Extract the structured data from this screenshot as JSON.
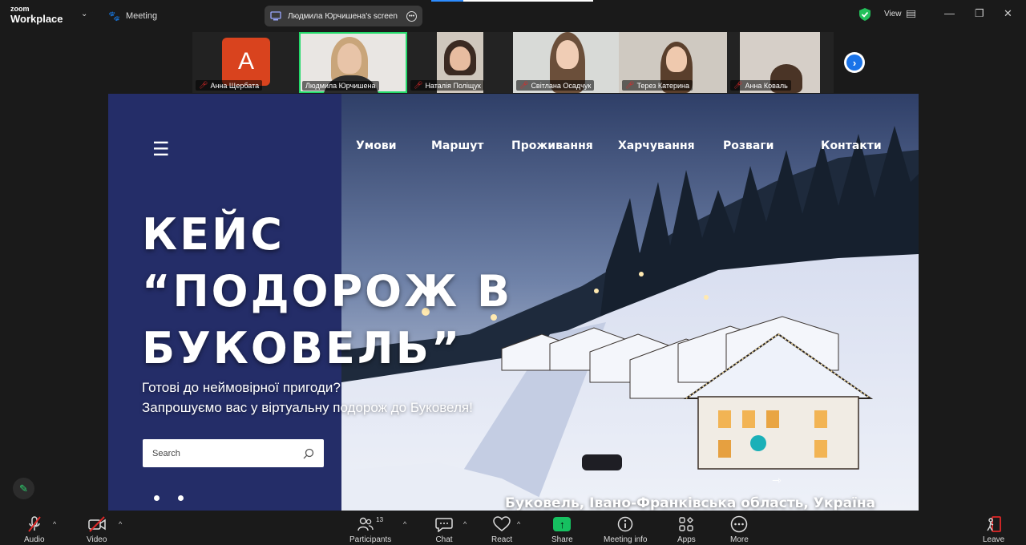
{
  "app": {
    "brand_top": "zoom",
    "brand_bottom": "Workplace",
    "meeting_label": "Meeting"
  },
  "screen_share": {
    "label": "Людмила Юрчишена's screen"
  },
  "window": {
    "view_label": "View"
  },
  "participants": [
    {
      "name": "Анна Щербата",
      "avatar_letter": "A",
      "muted": true
    },
    {
      "name": "Людмила Юрчишена",
      "muted": false,
      "active": true
    },
    {
      "name": "Наталія Поліщук",
      "muted": true
    },
    {
      "name": "Світлана Осадчук",
      "muted": true
    },
    {
      "name": "Терез Катерина",
      "muted": true
    },
    {
      "name": "Анна Коваль",
      "muted": true
    }
  ],
  "slide": {
    "nav": [
      "Умови",
      "Маршут",
      "Проживання",
      "Харчування",
      "Розваги",
      "Контакти"
    ],
    "menu_glyph": "☰",
    "title": "КЕЙС\n“ПОДОРОЖ В\nБУКОВЕЛЬ”",
    "subtitle": "Готові до неймовірної пригоди?\nЗапрошуємо вас у віртуальну подорож до Буковеля!",
    "search_placeholder": "Search",
    "caption": "Буковель, Івано-Франківська область, Україна"
  },
  "toolbar": {
    "audio": "Audio",
    "video": "Video",
    "participants": "Participants",
    "participants_count": "13",
    "chat": "Chat",
    "react": "React",
    "share": "Share",
    "meeting_info": "Meeting info",
    "apps": "Apps",
    "more": "More",
    "leave": "Leave"
  },
  "colors": {
    "slide_panel": "#242d68",
    "active_tile": "#23d96a",
    "share_green": "#16c060",
    "mute_red": "#e02828"
  }
}
